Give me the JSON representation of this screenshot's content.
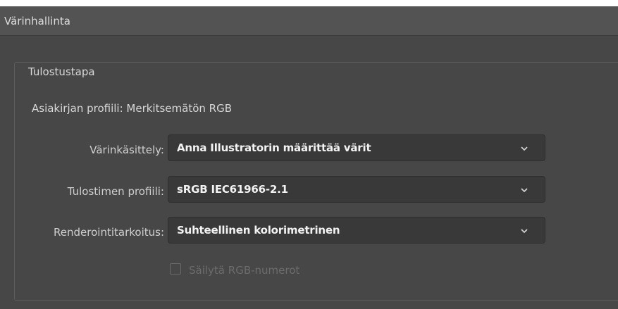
{
  "section": {
    "title": "Värinhallinta"
  },
  "group": {
    "legend": "Tulostustapa",
    "document_profile": "Asiakirjan profiili: Merkitsemätön RGB"
  },
  "color_handling": {
    "label": "Värinkäsittely:",
    "value": "Anna Illustratorin määrittää värit"
  },
  "printer_profile": {
    "label": "Tulostimen profiili:",
    "value": "sRGB IEC61966-2.1"
  },
  "rendering_intent": {
    "label": "Renderointitarkoitus:",
    "value": "Suhteellinen kolorimetrinen"
  },
  "preserve_rgb": {
    "label": "Säilytä RGB-numerot",
    "checked": false,
    "enabled": false
  },
  "icons": {
    "dropdown": "chevron-down-icon"
  },
  "colors": {
    "panel_bg": "#474747",
    "header_bg": "#535353",
    "dropdown_bg": "#393939"
  }
}
